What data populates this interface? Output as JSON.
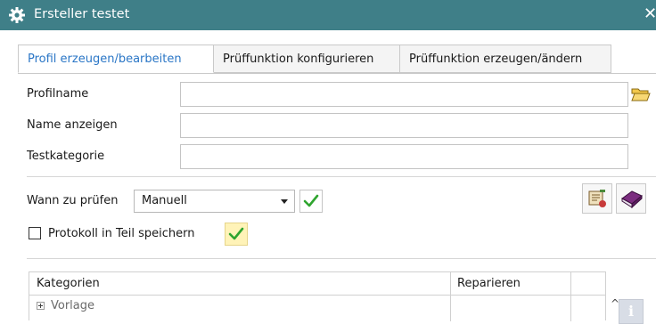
{
  "window": {
    "title": "Ersteller testet",
    "close_glyph": "✕",
    "icon": "gear-icon",
    "title_bar_color": "#3f7f88"
  },
  "tabs": [
    {
      "label": "Profil erzeugen/bearbeiten",
      "active": true
    },
    {
      "label": "Prüffunktion konfigurieren",
      "active": false
    },
    {
      "label": "Prüffunktion erzeugen/ändern",
      "active": false
    }
  ],
  "form": {
    "profile_name_label": "Profilname",
    "profile_name_value": "",
    "display_name_label": "Name anzeigen",
    "display_name_value": "",
    "test_category_label": "Testkategorie",
    "test_category_value": "",
    "when_check_label": "Wann zu prüfen",
    "when_check_value": "Manuell",
    "save_log_label": "Protokoll in Teil speichern",
    "save_log_checked": false
  },
  "grid": {
    "columns": [
      "Kategorien",
      "Reparieren"
    ],
    "rows": [
      {
        "category": "Vorlage",
        "repair": ""
      }
    ]
  },
  "colors": {
    "active_tab_text": "#2a76c6",
    "check_green": "#2fa52f",
    "highlight_yellow": "#fff3b8"
  }
}
